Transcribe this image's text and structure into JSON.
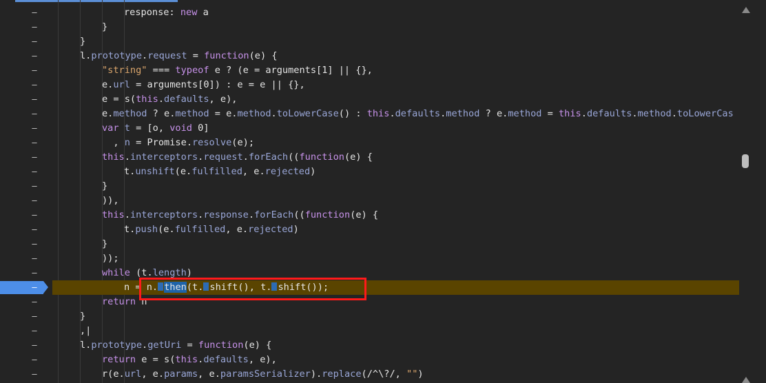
{
  "editor": {
    "gutter_marker": "–",
    "breakpoint_line": "–"
  },
  "code_lines": [
    {
      "id": "l0",
      "indent": 4,
      "tokens": [
        [
          "n",
          "response"
        ],
        [
          "n",
          ": "
        ],
        [
          "k",
          "new"
        ],
        [
          "n",
          " a"
        ]
      ]
    },
    {
      "id": "l1",
      "indent": 3,
      "tokens": [
        [
          "n",
          "}"
        ]
      ]
    },
    {
      "id": "l2",
      "indent": 2,
      "tokens": [
        [
          "n",
          "}"
        ]
      ]
    },
    {
      "id": "l3",
      "indent": 2,
      "tokens": [
        [
          "n",
          "l."
        ],
        [
          "p",
          "prototype"
        ],
        [
          "n",
          "."
        ],
        [
          "p",
          "request"
        ],
        [
          "n",
          " = "
        ],
        [
          "k",
          "function"
        ],
        [
          "n",
          "(e) {"
        ]
      ]
    },
    {
      "id": "l4",
      "indent": 3,
      "tokens": [
        [
          "s",
          "\"string\""
        ],
        [
          "n",
          " === "
        ],
        [
          "k",
          "typeof"
        ],
        [
          "n",
          " e ? (e = arguments[1] || {},"
        ]
      ]
    },
    {
      "id": "l5",
      "indent": 3,
      "tokens": [
        [
          "n",
          "e."
        ],
        [
          "p",
          "url"
        ],
        [
          "n",
          " = arguments[0]) : e = e || {},"
        ]
      ]
    },
    {
      "id": "l6",
      "indent": 3,
      "tokens": [
        [
          "n",
          "e = s("
        ],
        [
          "k",
          "this"
        ],
        [
          "n",
          "."
        ],
        [
          "p",
          "defaults"
        ],
        [
          "n",
          ", e),"
        ]
      ]
    },
    {
      "id": "l7",
      "indent": 3,
      "tokens": [
        [
          "n",
          "e."
        ],
        [
          "p",
          "method"
        ],
        [
          "n",
          " ? e."
        ],
        [
          "p",
          "method"
        ],
        [
          "n",
          " = e."
        ],
        [
          "p",
          "method"
        ],
        [
          "n",
          "."
        ],
        [
          "p",
          "toLowerCase"
        ],
        [
          "n",
          "() : "
        ],
        [
          "k",
          "this"
        ],
        [
          "n",
          "."
        ],
        [
          "p",
          "defaults"
        ],
        [
          "n",
          "."
        ],
        [
          "p",
          "method"
        ],
        [
          "n",
          " ? e."
        ],
        [
          "p",
          "method"
        ],
        [
          "n",
          " = "
        ],
        [
          "k",
          "this"
        ],
        [
          "n",
          "."
        ],
        [
          "p",
          "defaults"
        ],
        [
          "n",
          "."
        ],
        [
          "p",
          "method"
        ],
        [
          "n",
          "."
        ],
        [
          "p",
          "toLowerCas"
        ]
      ]
    },
    {
      "id": "l8",
      "indent": 3,
      "tokens": [
        [
          "k",
          "var"
        ],
        [
          "n",
          " "
        ],
        [
          "p",
          "t"
        ],
        [
          "n",
          " = [o, "
        ],
        [
          "k",
          "void"
        ],
        [
          "n",
          " 0]"
        ]
      ]
    },
    {
      "id": "l9",
      "indent": 3,
      "tokens": [
        [
          "n",
          "  , "
        ],
        [
          "p",
          "n"
        ],
        [
          "n",
          " = Promise."
        ],
        [
          "p",
          "resolve"
        ],
        [
          "n",
          "(e);"
        ]
      ]
    },
    {
      "id": "l10",
      "indent": 3,
      "tokens": [
        [
          "k",
          "this"
        ],
        [
          "n",
          "."
        ],
        [
          "p",
          "interceptors"
        ],
        [
          "n",
          "."
        ],
        [
          "p",
          "request"
        ],
        [
          "n",
          "."
        ],
        [
          "p",
          "forEach"
        ],
        [
          "n",
          "(("
        ],
        [
          "k",
          "function"
        ],
        [
          "n",
          "(e) {"
        ]
      ]
    },
    {
      "id": "l11",
      "indent": 4,
      "tokens": [
        [
          "n",
          "t."
        ],
        [
          "p",
          "unshift"
        ],
        [
          "n",
          "(e."
        ],
        [
          "p",
          "fulfilled"
        ],
        [
          "n",
          ", e."
        ],
        [
          "p",
          "rejected"
        ],
        [
          "n",
          ")"
        ]
      ]
    },
    {
      "id": "l12",
      "indent": 3,
      "tokens": [
        [
          "n",
          "}"
        ]
      ]
    },
    {
      "id": "l13",
      "indent": 3,
      "tokens": [
        [
          "n",
          ")),"
        ]
      ]
    },
    {
      "id": "l14",
      "indent": 3,
      "tokens": [
        [
          "k",
          "this"
        ],
        [
          "n",
          "."
        ],
        [
          "p",
          "interceptors"
        ],
        [
          "n",
          "."
        ],
        [
          "p",
          "response"
        ],
        [
          "n",
          "."
        ],
        [
          "p",
          "forEach"
        ],
        [
          "n",
          "(("
        ],
        [
          "k",
          "function"
        ],
        [
          "n",
          "(e) {"
        ]
      ]
    },
    {
      "id": "l15",
      "indent": 4,
      "tokens": [
        [
          "n",
          "t."
        ],
        [
          "p",
          "push"
        ],
        [
          "n",
          "(e."
        ],
        [
          "p",
          "fulfilled"
        ],
        [
          "n",
          ", e."
        ],
        [
          "p",
          "rejected"
        ],
        [
          "n",
          ")"
        ]
      ]
    },
    {
      "id": "l16",
      "indent": 3,
      "tokens": [
        [
          "n",
          "}"
        ]
      ]
    },
    {
      "id": "l17",
      "indent": 3,
      "tokens": [
        [
          "n",
          "));"
        ]
      ]
    },
    {
      "id": "l18",
      "indent": 3,
      "tokens": [
        [
          "k",
          "while"
        ],
        [
          "n",
          " (t."
        ],
        [
          "p",
          "length"
        ],
        [
          "n",
          ")"
        ]
      ]
    },
    {
      "id": "l19",
      "indent": 4,
      "exec": true,
      "tokens": [
        [
          "n",
          "n = n."
        ],
        [
          "mark",
          ""
        ],
        [
          "hl",
          "then"
        ],
        [
          "n",
          "(t."
        ],
        [
          "mark",
          ""
        ],
        [
          "n",
          "shift(), t."
        ],
        [
          "mark",
          ""
        ],
        [
          "n",
          "shift());"
        ]
      ]
    },
    {
      "id": "l20",
      "indent": 3,
      "tokens": [
        [
          "k",
          "return"
        ],
        [
          "n",
          " n"
        ]
      ]
    },
    {
      "id": "l21",
      "indent": 2,
      "tokens": [
        [
          "n",
          "}"
        ]
      ]
    },
    {
      "id": "l22",
      "indent": 2,
      "tokens": [
        [
          "n",
          ",|"
        ]
      ]
    },
    {
      "id": "l23",
      "indent": 2,
      "tokens": [
        [
          "n",
          "l."
        ],
        [
          "p",
          "prototype"
        ],
        [
          "n",
          "."
        ],
        [
          "p",
          "getUri"
        ],
        [
          "n",
          " = "
        ],
        [
          "k",
          "function"
        ],
        [
          "n",
          "(e) {"
        ]
      ]
    },
    {
      "id": "l24",
      "indent": 3,
      "tokens": [
        [
          "k",
          "return"
        ],
        [
          "n",
          " e = s("
        ],
        [
          "k",
          "this"
        ],
        [
          "n",
          "."
        ],
        [
          "p",
          "defaults"
        ],
        [
          "n",
          ", e),"
        ]
      ]
    },
    {
      "id": "l25",
      "indent": 3,
      "tokens": [
        [
          "n",
          "r(e."
        ],
        [
          "p",
          "url"
        ],
        [
          "n",
          ", e."
        ],
        [
          "p",
          "params"
        ],
        [
          "n",
          ", e."
        ],
        [
          "p",
          "paramsSerializer"
        ],
        [
          "n",
          ")."
        ],
        [
          "p",
          "replace"
        ],
        [
          "n",
          "(/^\\?/, "
        ],
        [
          "s",
          "\"\""
        ],
        [
          "n",
          ")"
        ]
      ]
    }
  ],
  "colors": {
    "background": "#242424",
    "execution_line": "#5a4400",
    "breakpoint": "#4d8ee8",
    "annotation_box": "#ff1a1a"
  }
}
